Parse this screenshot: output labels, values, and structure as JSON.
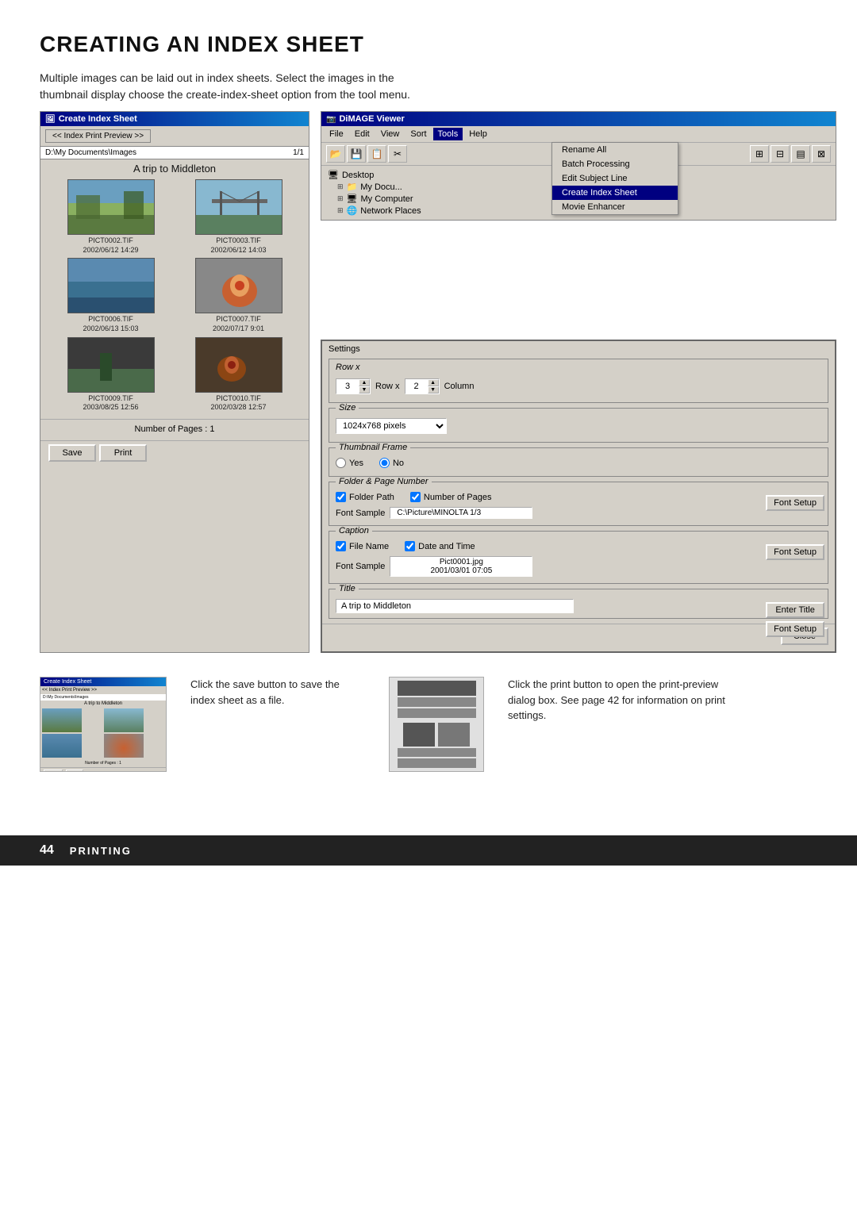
{
  "page": {
    "title": "CREATING AN INDEX SHEET",
    "intro": "Multiple images can be laid out in index sheets. Select the images in the thumbnail display choose the create-index-sheet option from the tool menu."
  },
  "footer": {
    "page_number": "44",
    "section": "PRINTING"
  },
  "create_index_window": {
    "title": "Create Index Sheet",
    "nav_button": "<< Index Print Preview >>",
    "folder_path": "D:\\My Documents\\Images",
    "page_info": "1/1",
    "album_title": "A trip to Middleton",
    "thumbnails": [
      {
        "filename": "PICT0002.TIF",
        "date": "2002/06/12 14:29",
        "type": "landscape"
      },
      {
        "filename": "PICT0003.TIF",
        "date": "2002/06/12 14:03",
        "type": "bridge"
      },
      {
        "filename": "PICT0006.TIF",
        "date": "2002/06/13 15:03",
        "type": "water"
      },
      {
        "filename": "PICT0007.TIF",
        "date": "2002/07/17  9:01",
        "type": "flower"
      },
      {
        "filename": "PICT0009.TIF",
        "date": "2003/08/25 12:56",
        "type": "dark-scene"
      },
      {
        "filename": "PICT0010.TIF",
        "date": "2002/03/28 12:57",
        "type": "dark-flower"
      }
    ],
    "num_pages_label": "Number of Pages :",
    "num_pages_value": "1",
    "save_button": "Save",
    "print_button": "Print"
  },
  "dimage_viewer": {
    "title": "DiMAGE Viewer",
    "menu_items": [
      "File",
      "Edit",
      "View",
      "Sort",
      "Tools",
      "Help"
    ],
    "tools_menu": {
      "items": [
        "Rename All",
        "Batch Processing",
        "Edit Subject Line",
        "Create Index Sheet",
        "Movie Enhancer"
      ]
    },
    "nav_tree": [
      "Desktop",
      "My Documents",
      "My Computer",
      "Network Places"
    ]
  },
  "settings_panel": {
    "title": "Settings",
    "row_x_column": {
      "label_row": "Row x",
      "row_value": "3",
      "label_col": "Column",
      "col_value": "2"
    },
    "size": {
      "label": "Size",
      "value": "1024x768 pixels"
    },
    "thumbnail_frame": {
      "label": "Thumbnail Frame",
      "options": [
        "Yes",
        "No"
      ],
      "selected": "No"
    },
    "folder_page_number": {
      "label": "Folder & Page Number",
      "folder_path_checked": true,
      "folder_path_label": "Folder Path",
      "num_pages_checked": true,
      "num_pages_label": "Number of Pages",
      "font_setup_button": "Font Setup",
      "font_sample_label": "Font Sample",
      "font_sample_value": "C:\\Picture\\MINOLTA  1/3"
    },
    "caption": {
      "label": "Caption",
      "file_name_checked": true,
      "file_name_label": "File Name",
      "date_time_checked": true,
      "date_time_label": "Date and Time",
      "font_setup_button": "Font Setup",
      "font_sample_label": "Font Sample",
      "font_sample_value": "Pict0001.jpg\n2001/03/01 07:05"
    },
    "title_section": {
      "label": "Title",
      "value": "A trip to Middleton",
      "enter_title_button": "Enter Title",
      "font_setup_button": "Font Setup"
    },
    "close_button": "Close"
  },
  "bottom_instructions": {
    "save_instruction": "Click the save button to save the index sheet as a file.",
    "print_instruction": "Click the print button to open the print-preview dialog box. See page 42 for information on print settings."
  }
}
